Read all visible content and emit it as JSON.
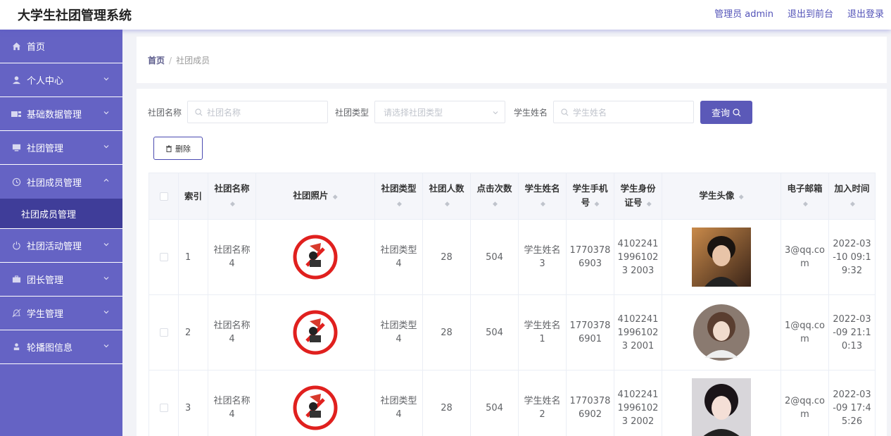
{
  "header": {
    "title": "大学生社团管理系统",
    "admin": "管理员 admin",
    "to_front": "退出到前台",
    "logout": "退出登录"
  },
  "sidebar": {
    "items": [
      {
        "label": "首页",
        "icon": "home-icon"
      },
      {
        "label": "个人中心",
        "icon": "user-icon"
      },
      {
        "label": "基础数据管理",
        "icon": "data-icon"
      },
      {
        "label": "社团管理",
        "icon": "monitor-icon"
      },
      {
        "label": "社团成员管理",
        "icon": "clock-icon"
      },
      {
        "label": "社团成员管理",
        "icon": "submenu"
      },
      {
        "label": "社团活动管理",
        "icon": "power-icon"
      },
      {
        "label": "团长管理",
        "icon": "briefcase-icon"
      },
      {
        "label": "学生管理",
        "icon": "bell-icon"
      },
      {
        "label": "轮播图信息",
        "icon": "person-icon"
      }
    ]
  },
  "breadcrumb": {
    "home": "首页",
    "sep": "/",
    "current": "社团成员"
  },
  "filters": {
    "club_name_label": "社团名称",
    "club_name_placeholder": "社团名称",
    "club_type_label": "社团类型",
    "club_type_placeholder": "请选择社团类型",
    "student_name_label": "学生姓名",
    "student_name_placeholder": "学生姓名",
    "query_label": "查询"
  },
  "actions": {
    "delete_label": "删除"
  },
  "table": {
    "headers": {
      "index": "索引",
      "club_name": "社团名称",
      "club_photo": "社团照片",
      "club_type": "社团类型",
      "club_count": "社团人数",
      "clicks": "点击次数",
      "student_name": "学生姓名",
      "phone": "学生手机号",
      "id_card": "学生身份证号",
      "avatar": "学生头像",
      "email": "电子邮箱",
      "join_time": "加入时间"
    },
    "rows": [
      {
        "index": "1",
        "club_name": "社团名称4",
        "club_type": "社团类型4",
        "club_count": "28",
        "clicks": "504",
        "student_name": "学生姓名3",
        "phone": "17703786903",
        "id_card": "410224119961023 2003",
        "email": "3@qq.com",
        "join_time": "2022-03-10 09:19:32"
      },
      {
        "index": "2",
        "club_name": "社团名称4",
        "club_type": "社团类型4",
        "club_count": "28",
        "clicks": "504",
        "student_name": "学生姓名1",
        "phone": "17703786901",
        "id_card": "410224119961023 2001",
        "email": "1@qq.com",
        "join_time": "2022-03-09 21:10:13"
      },
      {
        "index": "3",
        "club_name": "社团名称4",
        "club_type": "社团类型4",
        "club_count": "28",
        "clicks": "504",
        "student_name": "学生姓名2",
        "phone": "17703786902",
        "id_card": "410224119961023 2002",
        "email": "2@qq.com",
        "join_time": "2022-03-09 17:45:26"
      }
    ]
  },
  "colors": {
    "sidebar_bg": "#6563c4",
    "sidebar_active": "#3f3d99",
    "accent": "#5b59b8"
  }
}
